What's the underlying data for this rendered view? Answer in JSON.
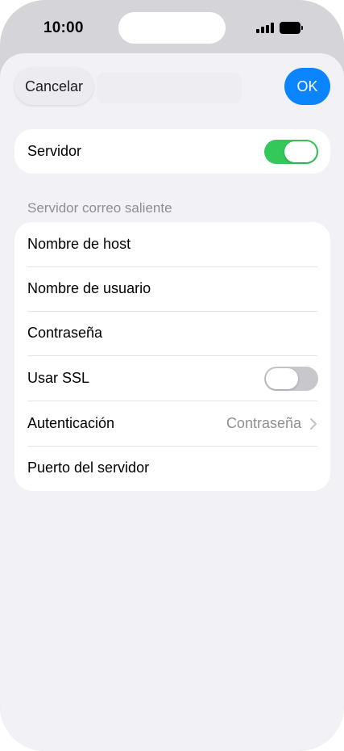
{
  "status_bar": {
    "time": "10:00"
  },
  "nav": {
    "cancel_label": "Cancelar",
    "ok_label": "OK"
  },
  "server_card": {
    "label": "Servidor",
    "toggle_on": true
  },
  "outgoing": {
    "header": "Servidor correo saliente",
    "rows": [
      {
        "label": "Nombre de host"
      },
      {
        "label": "Nombre de usuario"
      },
      {
        "label": "Contraseña"
      },
      {
        "label": "Usar SSL",
        "toggle_on": false
      },
      {
        "label": "Autenticación",
        "value": "Contraseña"
      },
      {
        "label": "Puerto del servidor"
      }
    ]
  },
  "colors": {
    "accent": "#0a84ff",
    "toggle_on": "#34c759",
    "toggle_off": "#c7c7cc",
    "background": "#f1f1f6"
  },
  "icons": {
    "signal": "cellular-signal-icon",
    "battery": "battery-icon",
    "chevron": "chevron-right-icon"
  }
}
